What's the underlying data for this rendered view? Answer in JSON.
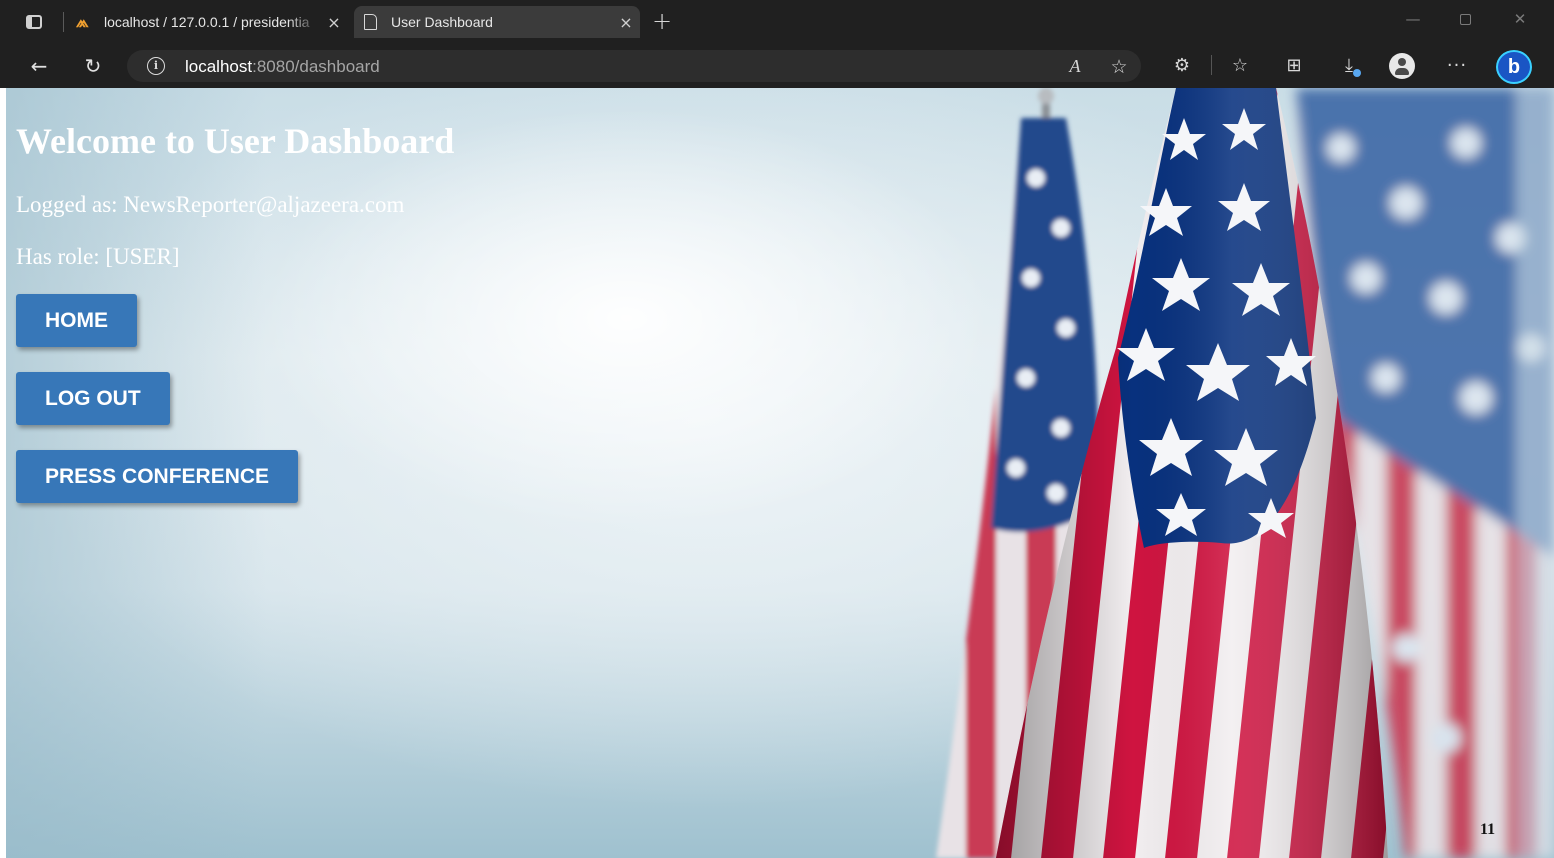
{
  "browser": {
    "tabs": [
      {
        "title": "localhost / 127.0.0.1 / presidentia",
        "icon": "phpmyadmin-icon",
        "active": false
      },
      {
        "title": "User Dashboard",
        "icon": "page-icon",
        "active": true
      }
    ],
    "address": {
      "host": "localhost",
      "rest": ":8080/dashboard"
    },
    "icons": {
      "tab_close": "×",
      "new_tab": "+",
      "back": "←",
      "reload": "↻",
      "info": "i",
      "read_aloud": "A",
      "favorite_add": "☆",
      "extensions": "⚙",
      "favorites": "☆",
      "collections": "⊞",
      "downloads": "⤓",
      "more": "···",
      "bing": "b",
      "minimize": "—",
      "close": "✕"
    }
  },
  "page": {
    "title": "Welcome to User Dashboard",
    "logged_as": "Logged as: NewsReporter@aljazeera.com",
    "role": "Has role: [USER]",
    "buttons": {
      "home": "HOME",
      "logout": "LOG OUT",
      "press": "PRESS CONFERENCE"
    },
    "page_number": "11"
  },
  "colors": {
    "button": "#3777b8",
    "flag_red": "#c8143c",
    "flag_blue": "#0a2a78",
    "chrome": "#202020"
  }
}
